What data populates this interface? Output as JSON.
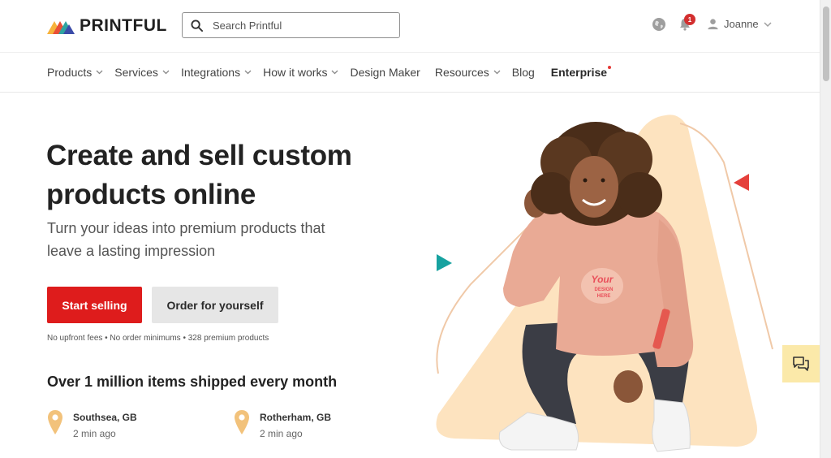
{
  "header": {
    "logo_text": "PRINTFUL",
    "search_placeholder": "Search Printful",
    "notification_count": "1",
    "user_name": "Joanne"
  },
  "nav": {
    "items": [
      {
        "label": "Products",
        "has_dropdown": true
      },
      {
        "label": "Services",
        "has_dropdown": true
      },
      {
        "label": "Integrations",
        "has_dropdown": true
      },
      {
        "label": "How it works",
        "has_dropdown": true
      },
      {
        "label": "Design Maker",
        "has_dropdown": false
      },
      {
        "label": "Resources",
        "has_dropdown": true
      },
      {
        "label": "Blog",
        "has_dropdown": false
      },
      {
        "label": "Enterprise",
        "has_dropdown": false
      }
    ]
  },
  "hero": {
    "title": "Create and sell custom products online",
    "subtitle": "Turn your ideas into premium products that leave a lasting impression",
    "primary_cta": "Start selling",
    "secondary_cta": "Order for yourself",
    "fine_print": "No upfront fees • No order minimums • 328 premium products"
  },
  "shipping": {
    "heading": "Over 1 million items shipped every month",
    "orders": [
      {
        "city": "Southsea, GB",
        "time": "2 min ago"
      },
      {
        "city": "Rotherham, GB",
        "time": "2 min ago"
      }
    ]
  },
  "artwork": {
    "shirt_print_line1": "Your",
    "shirt_print_line2": "DESIGN",
    "shirt_print_line3": "HERE"
  },
  "colors": {
    "accent_red": "#de1c1c",
    "peach_triangle": "#fde3bf",
    "teal_triangle": "#17a2a0",
    "pin_color": "#f2c27b",
    "chat_bg": "#fbe9a9"
  },
  "icons": {
    "search": "search-icon",
    "globe": "globe-icon",
    "bell": "bell-icon",
    "user": "user-icon",
    "chat": "chat-icon",
    "pin": "location-pin-icon"
  }
}
